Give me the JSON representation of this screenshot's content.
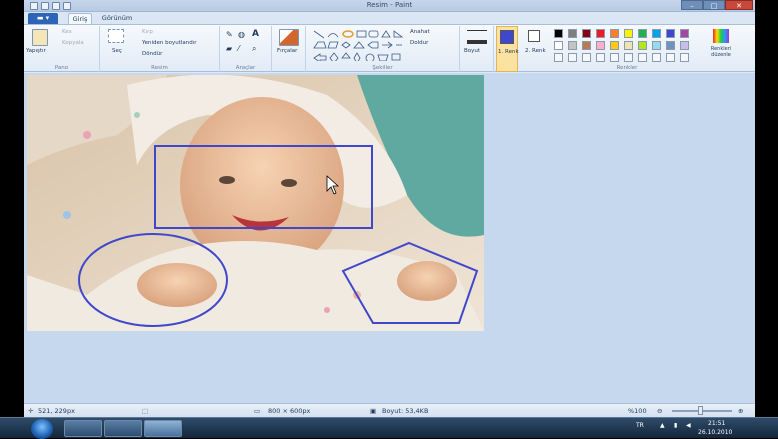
{
  "window": {
    "title": "Resim - Paint",
    "minimize": "–",
    "maximize": "□",
    "close": "✕"
  },
  "tabs": {
    "file": "▬ ▾",
    "home": "Giriş",
    "view": "Görünüm"
  },
  "ribbon": {
    "clipboard": {
      "paste": "Yapıştır",
      "cut": "Kes",
      "copy": "Kopyala",
      "label": "Pano"
    },
    "image": {
      "select": "Seç",
      "crop": "Kırp",
      "resize": "Yeniden boyutlandır",
      "rotate": "Döndür",
      "label": "Resim"
    },
    "tools": {
      "label": "Araçlar"
    },
    "brushes": {
      "label": "Fırçalar"
    },
    "shapes": {
      "outline": "Anahat",
      "fill": "Doldur",
      "label": "Şekiller"
    },
    "size": {
      "label": "Boyut"
    },
    "color1": {
      "label": "1. Renk"
    },
    "color2": {
      "label": "2. Renk"
    },
    "edit_colors": {
      "label": "Renkleri düzenle"
    },
    "colors": {
      "label": "Renkler"
    }
  },
  "palette": {
    "row1": [
      "#000000",
      "#7f7f7f",
      "#880015",
      "#ed1c24",
      "#ff7f27",
      "#fff200",
      "#22b14c",
      "#00a2e8",
      "#3f48cc",
      "#a349a4"
    ],
    "row2": [
      "#ffffff",
      "#c3c3c3",
      "#b97a57",
      "#ffaec9",
      "#ffc90e",
      "#efe4b0",
      "#b5e61d",
      "#99d9ea",
      "#7092be",
      "#c8bfe7"
    ],
    "row3": [
      "#f4f7fb",
      "#f4f7fb",
      "#f4f7fb",
      "#f4f7fb",
      "#f4f7fb",
      "#f4f7fb",
      "#f4f7fb",
      "#f4f7fb",
      "#f4f7fb",
      "#f4f7fb"
    ],
    "color1": "#3f48cc",
    "color2": "#ffffff",
    "shape_color": "#3f48cc"
  },
  "status": {
    "cursor": "521, 229px",
    "dimensions": "800 × 600px",
    "size": "Boyut: 53,4KB",
    "zoom": "%100"
  },
  "taskbar": {
    "lang": "TR",
    "time": "21:51",
    "date": "26.10.2010"
  }
}
